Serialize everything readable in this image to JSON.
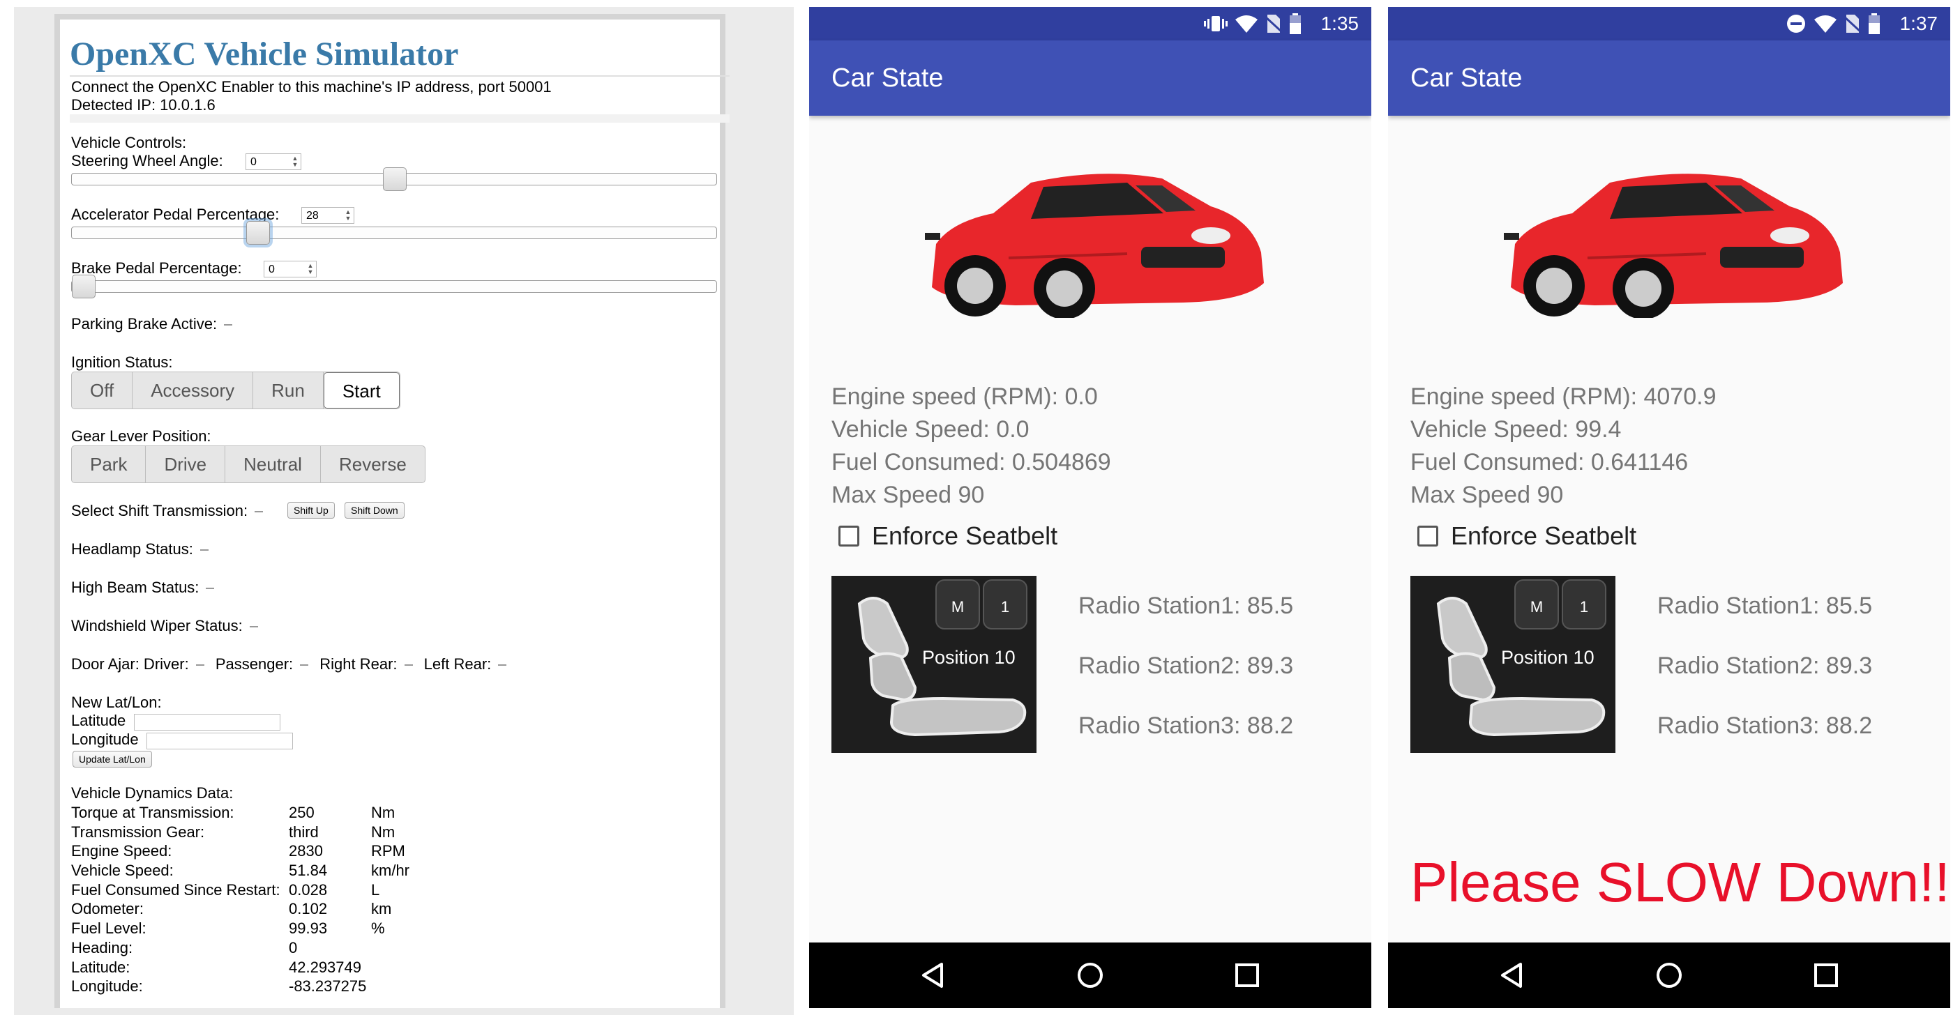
{
  "simulator": {
    "title": "OpenXC Vehicle Simulator",
    "connect_text": "Connect the OpenXC Enabler to this machine's IP address, port 50001",
    "detected_ip": "Detected IP: 10.0.1.6",
    "vehicle_controls_label": "Vehicle Controls:",
    "steering_label": "Steering Wheel Angle:",
    "steering_value": "0",
    "steering_level": 0.5,
    "accelerator_label": "Accelerator Pedal Percentage:",
    "accelerator_value": "28",
    "accelerator_level": 0.28,
    "brake_label": "Brake Pedal Percentage:",
    "brake_value": "0",
    "brake_level": 0,
    "parking_brake_label": "Parking Brake Active:",
    "ignition_label": "Ignition Status:",
    "ignition_options": [
      "Off",
      "Accessory",
      "Run",
      "Start"
    ],
    "ignition_selected": "Start",
    "gear_label": "Gear Lever Position:",
    "gear_options": [
      "Park",
      "Drive",
      "Neutral",
      "Reverse"
    ],
    "shift_label": "Select Shift Transmission:",
    "shift_up": "Shift Up",
    "shift_down": "Shift Down",
    "headlamp_label": "Headlamp Status:",
    "high_beam_label": "High Beam Status:",
    "wiper_label": "Windshield Wiper Status:",
    "door_ajar_label": "Door Ajar: Driver:",
    "door_passenger": "Passenger:",
    "door_right_rear": "Right Rear:",
    "door_left_rear": "Left Rear:",
    "latlon_label": "New Lat/Lon:",
    "latitude_label": "Latitude",
    "longitude_label": "Longitude",
    "update_latlon": "Update Lat/Lon",
    "dynamics_label": "Vehicle Dynamics Data:",
    "dynamics": [
      {
        "label": "Torque at Transmission:",
        "value": "250",
        "unit": "Nm"
      },
      {
        "label": "Transmission Gear:",
        "value": "third",
        "unit": "Nm"
      },
      {
        "label": "Engine Speed:",
        "value": "2830",
        "unit": "RPM"
      },
      {
        "label": "Vehicle Speed:",
        "value": "51.84",
        "unit": "km/hr"
      },
      {
        "label": "Fuel Consumed Since Restart:",
        "value": "0.028",
        "unit": "L"
      },
      {
        "label": "Odometer:",
        "value": "0.102",
        "unit": "km"
      },
      {
        "label": "Fuel Level:",
        "value": "99.93",
        "unit": "%"
      },
      {
        "label": "Heading:",
        "value": "0",
        "unit": ""
      },
      {
        "label": "Latitude:",
        "value": "42.293749",
        "unit": ""
      },
      {
        "label": "Longitude:",
        "value": "-83.237275",
        "unit": ""
      }
    ]
  },
  "phones": [
    {
      "status_time": "1:35",
      "app_title": "Car State",
      "engine_speed": "Engine speed (RPM): 0.0",
      "vehicle_speed": "Vehicle Speed: 0.0",
      "fuel_consumed": "Fuel Consumed: 0.504869",
      "max_speed": "Max Speed 90",
      "seatbelt_label": "Enforce Seatbelt",
      "seat_position": "Position 10",
      "radio1": "Radio Station1: 85.5",
      "radio2": "Radio Station2: 89.3",
      "radio3": "Radio Station3: 88.2",
      "warning": ""
    },
    {
      "status_time": "1:37",
      "app_title": "Car State",
      "engine_speed": "Engine speed (RPM): 4070.9",
      "vehicle_speed": "Vehicle Speed: 99.4",
      "fuel_consumed": "Fuel Consumed: 0.641146",
      "max_speed": "Max Speed 90",
      "seatbelt_label": "Enforce Seatbelt",
      "seat_position": "Position 10",
      "radio1": "Radio Station1: 85.5",
      "radio2": "Radio Station2: 89.3",
      "radio3": "Radio Station3: 88.2",
      "warning": "Please SLOW Down!!!"
    }
  ],
  "colors": {
    "app_bar": "#3f51b5",
    "status_bar": "#303f9f",
    "warning": "#e8102a",
    "sim_title": "#3a7aa8"
  }
}
